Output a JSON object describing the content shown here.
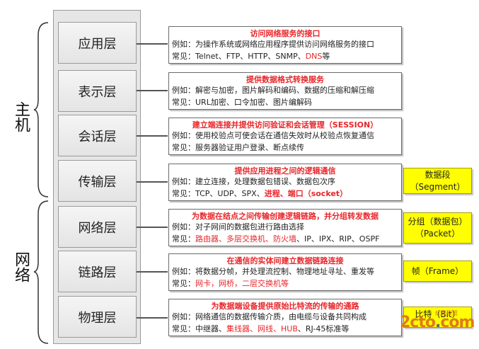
{
  "groups": {
    "host": "主机",
    "network": "网络"
  },
  "layers": [
    {
      "name": "应用层",
      "title": "访问网络服务的接口",
      "line1": "例如：为操作系统或网络应用程序提供访问网络服务的接口",
      "line2_prefix": "常见：Telnet、FTP、HTTP、SNMP、",
      "line2_red": "DNS",
      "line2_suffix": "等"
    },
    {
      "name": "表示层",
      "title": "提供数据格式转换服务",
      "line1": "例如：解密与加密，图片解码和编码、数据的压缩和解压缩",
      "line2_prefix": "常见：URL加密、口令加密、图片编解码",
      "line2_red": "",
      "line2_suffix": ""
    },
    {
      "name": "会话层",
      "title": "建立端连接并提供访问验证和会话管理（SESSION）",
      "line1": "例如：使用校验点可使会话在通信失效时从校验点恢复通信",
      "line2_prefix": "常见：服务器验证用户登录、断点续传",
      "line2_red": "",
      "line2_suffix": ""
    },
    {
      "name": "传输层",
      "title": "提供应用进程之间的逻辑通信",
      "line1": "例如：建立连接，处理数据包错误、数据包次序",
      "line2_prefix": "常见：TCP、UDP、SPX、",
      "line2_red": "进程、端口（socket）",
      "line2_suffix": ""
    },
    {
      "name": "网络层",
      "title": "为数据在结点之间传输创建逻辑链路，并分组转发数据",
      "line1": "例如：对子网间的数据包进行路由选择",
      "line2_prefix": "常见：",
      "line2_red": "路由器、多层交换机、防火墙",
      "line2_suffix": "、IP、IPX、RIP、OSPF"
    },
    {
      "name": "链路层",
      "title": "在通信的实体间建立数据链路连接",
      "line1": "例如：将数据分帧，并处理流控制、物理地址寻址、重发等",
      "line2_prefix": "常见：",
      "line2_red": "网卡，网桥，二层交换机等",
      "line2_suffix": ""
    },
    {
      "name": "物理层",
      "title": "为数据端设备提供原始比特流的传输的通路",
      "line1": "例如：网络通信的数据传输介质，由电缆与设备共同构成",
      "line2_prefix": "常见：中继器、",
      "line2_red": "集线器、网线、HUB",
      "line2_suffix": "、RJ-45标准等"
    }
  ],
  "pdus": [
    {
      "line1": "数据段",
      "line2": "（Segment）"
    },
    {
      "line1": "分组（数据包）",
      "line2": "（Packet）"
    },
    {
      "line1": "帧（Frame）",
      "line2": ""
    },
    {
      "line1": "比特（Bit）",
      "line2": ""
    }
  ],
  "watermark": {
    "main": "2cto",
    "dot": ".",
    "tld": "com",
    "sub": "红黑联盟"
  },
  "colors": {
    "highlight": "#e8262a",
    "pdu_fill": "#ffff00",
    "layer_fill": "#ececec",
    "watermark": "#e07b1a"
  }
}
